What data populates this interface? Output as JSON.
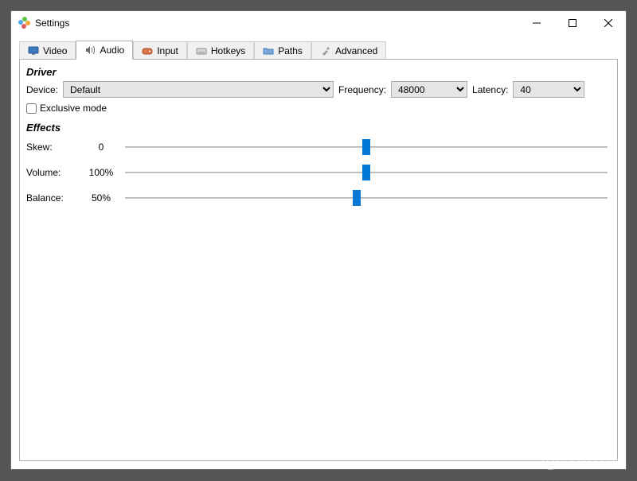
{
  "window": {
    "title": "Settings"
  },
  "tabs": [
    {
      "label": "Video"
    },
    {
      "label": "Audio"
    },
    {
      "label": "Input"
    },
    {
      "label": "Hotkeys"
    },
    {
      "label": "Paths"
    },
    {
      "label": "Advanced"
    }
  ],
  "active_tab": 1,
  "driver": {
    "section_label": "Driver",
    "device_label": "Device:",
    "device_value": "Default",
    "frequency_label": "Frequency:",
    "frequency_value": "48000",
    "latency_label": "Latency:",
    "latency_value": "40",
    "exclusive_label": "Exclusive mode",
    "exclusive_checked": false
  },
  "effects": {
    "section_label": "Effects",
    "skew": {
      "label": "Skew:",
      "value_text": "0",
      "percent": 50
    },
    "volume": {
      "label": "Volume:",
      "value_text": "100%",
      "percent": 50
    },
    "balance": {
      "label": "Balance:",
      "value_text": "50%",
      "percent": 48
    }
  },
  "watermark": "LO4D.com"
}
